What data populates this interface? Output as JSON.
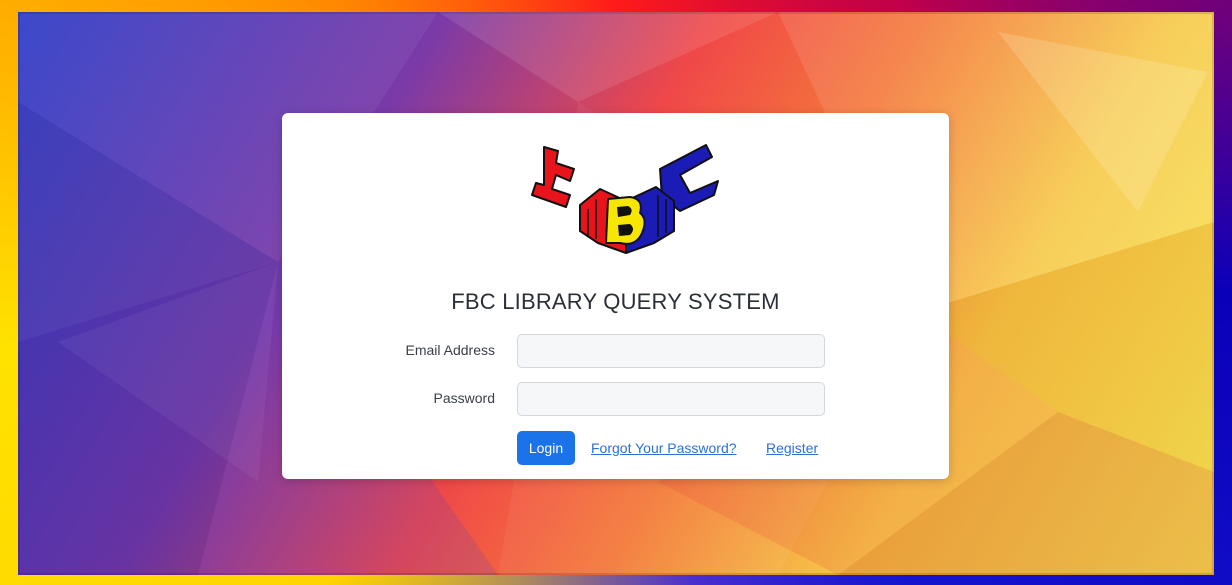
{
  "app": {
    "title": "FBC LIBRARY QUERY SYSTEM",
    "logo_text": "FBC"
  },
  "form": {
    "email_label": "Email Address",
    "email_value": "",
    "email_placeholder": "",
    "password_label": "Password",
    "password_value": "",
    "password_placeholder": ""
  },
  "actions": {
    "login_label": "Login",
    "forgot_label": "Forgot Your Password?",
    "register_label": "Register"
  },
  "colors": {
    "primary_button": "#1a73e8",
    "link": "#2f6fd6",
    "logo_red": "#e8141c",
    "logo_yellow": "#f7e600",
    "logo_blue": "#1b1bb5"
  }
}
